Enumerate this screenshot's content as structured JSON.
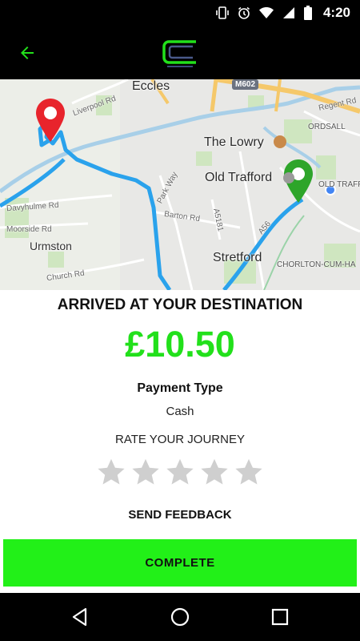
{
  "status_bar": {
    "time": "4:20",
    "icons": [
      "vibrate-icon",
      "alarm-icon",
      "wifi-icon",
      "signal-icon",
      "battery-icon"
    ]
  },
  "app_bar": {
    "back_icon": "arrow-left-icon",
    "logo_icon": "app-logo-icon",
    "accent_color": "#22e01b"
  },
  "map": {
    "labels": {
      "eccles": "Eccles",
      "the_lowry": "The Lowry",
      "old_trafford": "Old Trafford",
      "old_traff": "OLD TRAFF",
      "ordsall": "ORDSALL",
      "urmston": "Urmston",
      "stretford": "Stretford",
      "chorlton": "CHORLTON-CUM-HA",
      "m602": "M602",
      "liverpool_rd": "Liverpool Rd",
      "regent_rd": "Regent Rd",
      "park_way": "Park Way",
      "barton_rd": "Barton Rd",
      "davyhulme_rd": "Davyhulme Rd",
      "moorside_rd": "Moorside Rd",
      "church_rd": "Church Rd",
      "a5181": "A5181",
      "a56": "A56"
    },
    "start_marker_color": "#e8242c",
    "end_marker_color": "#2ea52a",
    "route_color": "#2aa2ec"
  },
  "trip": {
    "heading": "ARRIVED AT YOUR DESTINATION",
    "fare": "£10.50",
    "payment_type_label": "Payment Type",
    "payment_type_value": "Cash",
    "rate_label": "RATE YOUR JOURNEY",
    "rating": 0,
    "max_rating": 5,
    "feedback_label": "SEND FEEDBACK",
    "complete_label": "COMPLETE",
    "complete_color": "#22f018"
  },
  "nav_bar": {
    "icons": [
      "back-triangle-icon",
      "home-circle-icon",
      "recents-square-icon"
    ]
  }
}
